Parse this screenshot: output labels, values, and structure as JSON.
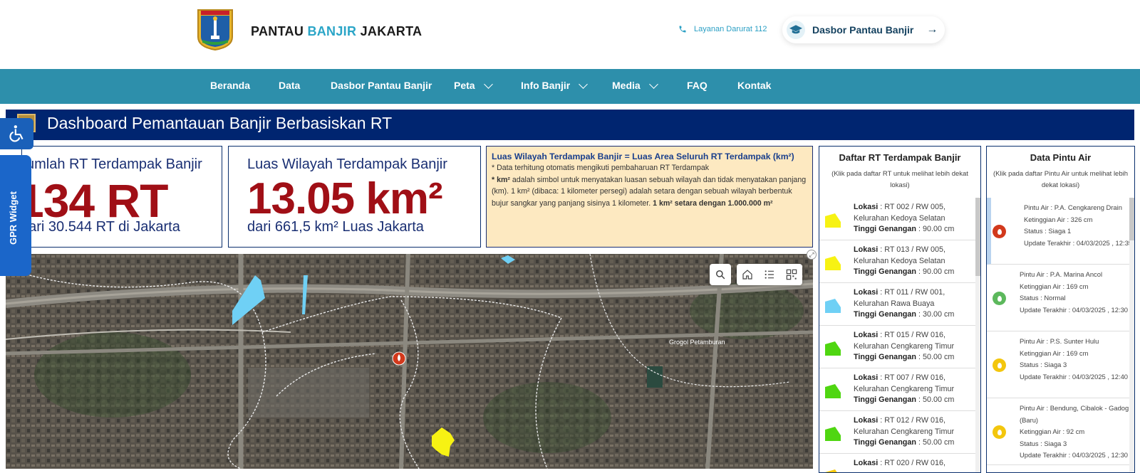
{
  "header": {
    "brand_part1": "PANTAU",
    "brand_part2": "BANJIR",
    "brand_part3": "JAKARTA",
    "emergency_label": "Layanan Darurat 112",
    "dashboard_button": "Dasbor Pantau Banjir",
    "logo_text": "JAYA RAYA"
  },
  "nav": {
    "items": [
      {
        "label": "Beranda",
        "dropdown": false
      },
      {
        "label": "Data",
        "dropdown": false
      },
      {
        "label": "Dasbor Pantau Banjir",
        "dropdown": false
      },
      {
        "label": "Peta",
        "dropdown": true
      },
      {
        "label": "Info Banjir",
        "dropdown": true
      },
      {
        "label": "Media",
        "dropdown": true
      },
      {
        "label": "FAQ",
        "dropdown": false
      },
      {
        "label": "Kontak",
        "dropdown": false
      }
    ]
  },
  "banner": {
    "title": "Dashboard Pemantauan Banjir Berbasiskan RT"
  },
  "stats": {
    "rt": {
      "label": "Jumlah RT Terdampak Banjir",
      "value": "134 RT",
      "sub": "dari 30.544 RT di Jakarta"
    },
    "area": {
      "label": "Luas Wilayah Terdampak Banjir",
      "value": "13.05 km²",
      "sub": "dari 661,5 km² Luas Jakarta"
    }
  },
  "info": {
    "title": "Luas Wilayah Terdampak Banjir = Luas Area Seluruh RT Terdampak (km²)",
    "line1": "* Data terhitung otomatis mengikuti pembaharuan RT Terdampak",
    "line2_bold": "* km²",
    "line2_rest": " adalah simbol untuk menyatakan luasan sebuah wilayah dan tidak menyatakan panjang (km). 1 km² (dibaca: 1 kilometer persegi) adalah setara dengan sebuah wilayah berbentuk bujur sangkar yang panjang sisinya 1 kilometer. ",
    "line2_tail_bold": "1 km² setara dengan 1.000.000 m²"
  },
  "rt_panel": {
    "title": "Daftar RT Terdampak Banjir",
    "note": "(Klik pada daftar RT untuk melihat lebih dekat lokasi)",
    "location_label": "Lokasi",
    "depth_label": "Tinggi Genangan",
    "items": [
      {
        "lokasi": "RT 002 / RW 005, Kelurahan Kedoya Selatan",
        "tinggi": "90.00 cm",
        "color": "#f7f213"
      },
      {
        "lokasi": "RT 013 / RW 005, Kelurahan Kedoya Selatan",
        "tinggi": "90.00 cm",
        "color": "#f7f213"
      },
      {
        "lokasi": "RT 011 / RW 001, Kelurahan Rawa Buaya",
        "tinggi": "30.00 cm",
        "color": "#6fd0f5"
      },
      {
        "lokasi": "RT 015 / RW 016, Kelurahan Cengkareng Timur",
        "tinggi": "50.00 cm",
        "color": "#4fd611"
      },
      {
        "lokasi": "RT 007 / RW 016, Kelurahan Cengkareng Timur",
        "tinggi": "50.00 cm",
        "color": "#4fd611"
      },
      {
        "lokasi": "RT 012 / RW 016, Kelurahan Cengkareng Timur",
        "tinggi": "50.00 cm",
        "color": "#4fd611"
      },
      {
        "lokasi": "RT 020 / RW 016,",
        "tinggi": "",
        "color": "#f7c90d"
      }
    ]
  },
  "pa_panel": {
    "title": "Data Pintu Air",
    "note": "(Klik pada daftar Pintu Air untuk melihat lebih dekat lokasi)",
    "items": [
      {
        "name": "Pintu Air : P.A. Cengkareng Drain",
        "level": "Ketinggian Air : 326 cm",
        "status": "Status : Siaga 1",
        "updated": "Update Terakhir : 04/03/2025 , 12:35",
        "color": "#d2391c",
        "active": true
      },
      {
        "name": "Pintu Air : P.A. Marina Ancol",
        "level": "Ketinggian Air : 169 cm",
        "status": "Status : Normal",
        "updated": "Update Terakhir : 04/03/2025 , 12:30",
        "color": "#5cb85c",
        "active": false
      },
      {
        "name": "Pintu Air : P.S. Sunter Hulu",
        "level": "Ketinggian Air : 169 cm",
        "status": "Status : Siaga 3",
        "updated": "Update Terakhir : 04/03/2025 , 12:40",
        "color": "#f3c60d",
        "active": false
      },
      {
        "name": "Pintu Air : Bendung, Cibalok - Gadog (Baru)",
        "level": "Ketinggian Air : 92 cm",
        "status": "Status : Siaga 3",
        "updated": "Update Terakhir : 04/03/2025 , 12:30",
        "color": "#f3c60d",
        "active": false
      }
    ]
  },
  "map": {
    "place_label": "Grogol Petamburan"
  },
  "widgets": {
    "gpr": "GPR Widget"
  }
}
